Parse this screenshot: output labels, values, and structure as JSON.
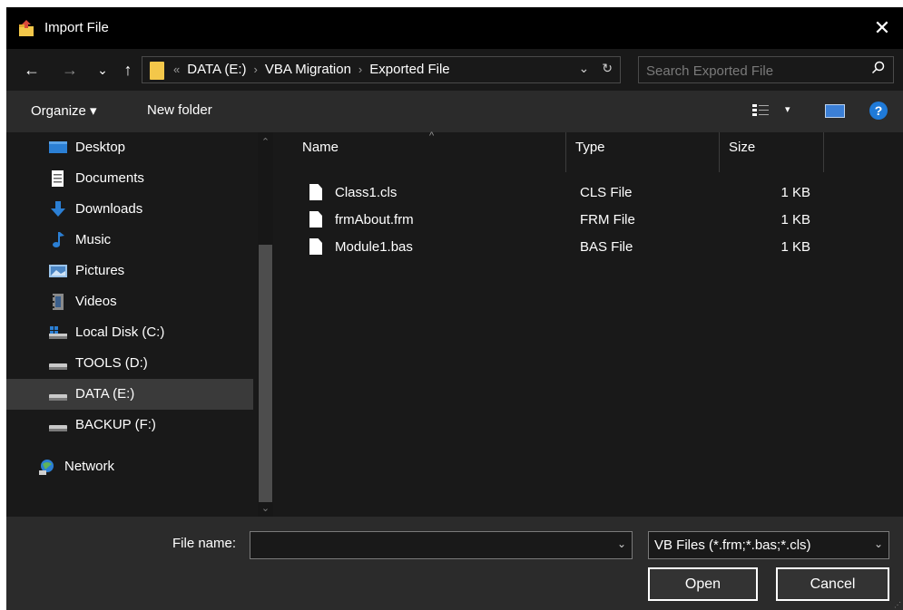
{
  "window": {
    "title": "Import File",
    "close_glyph": "✕"
  },
  "nav": {
    "back_glyph": "←",
    "forward_glyph": "→",
    "recent_glyph": "⌄",
    "up_glyph": "↑",
    "address": {
      "overflow": "«",
      "crumbs": [
        "DATA (E:)",
        "VBA Migration",
        "Exported File"
      ],
      "separator": "›",
      "dropdown_glyph": "⌄",
      "refresh_glyph": "↻"
    },
    "search": {
      "placeholder": "Search Exported File",
      "icon": "search-icon"
    }
  },
  "toolbar": {
    "organize_label": "Organize ▾",
    "new_folder_label": "New folder",
    "view_menu_glyph": "▾",
    "help_glyph": "?"
  },
  "sidebar": {
    "items": [
      {
        "label": "Desktop",
        "icon": "desktop-icon"
      },
      {
        "label": "Documents",
        "icon": "documents-icon"
      },
      {
        "label": "Downloads",
        "icon": "downloads-icon"
      },
      {
        "label": "Music",
        "icon": "music-icon"
      },
      {
        "label": "Pictures",
        "icon": "pictures-icon"
      },
      {
        "label": "Videos",
        "icon": "videos-icon"
      },
      {
        "label": "Local Disk (C:)",
        "icon": "local-disk-icon"
      },
      {
        "label": "TOOLS (D:)",
        "icon": "drive-icon"
      },
      {
        "label": "DATA (E:)",
        "icon": "drive-icon",
        "selected": true
      },
      {
        "label": "BACKUP (F:)",
        "icon": "drive-icon"
      },
      {
        "label": "Network",
        "icon": "network-icon"
      }
    ],
    "scroll_up_glyph": "⌃",
    "scroll_down_glyph": "⌄"
  },
  "file_list": {
    "columns": {
      "name": "Name",
      "type": "Type",
      "size": "Size"
    },
    "sort_glyph": "^",
    "rows": [
      {
        "name": "Class1.cls",
        "type": "CLS File",
        "size": "1 KB"
      },
      {
        "name": "frmAbout.frm",
        "type": "FRM File",
        "size": "1 KB"
      },
      {
        "name": "Module1.bas",
        "type": "BAS File",
        "size": "1 KB"
      }
    ]
  },
  "footer": {
    "file_name_label": "File name:",
    "file_name_value": "",
    "dropdown_glyph": "⌄",
    "filter_label": "VB Files (*.frm;*.bas;*.cls)",
    "open_label": "Open",
    "cancel_label": "Cancel"
  },
  "colors": {
    "window_bg": "#191919",
    "titlebar_bg": "#000000",
    "toolbar_bg": "#2b2b2b",
    "selected_bg": "#3a3a3a",
    "folder_yellow": "#f3c74a",
    "accent_blue": "#1f7ad8"
  }
}
